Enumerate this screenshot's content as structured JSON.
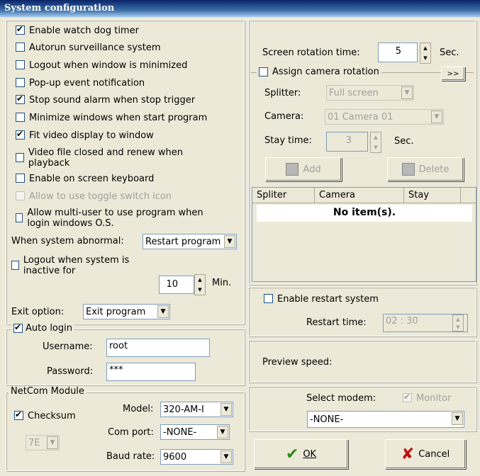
{
  "window": {
    "title": "System configuration"
  },
  "options": [
    {
      "label": "Enable watch dog timer",
      "checked": true
    },
    {
      "label": "Autorun surveillance system",
      "checked": false
    },
    {
      "label": "Logout when window is minimized",
      "checked": false
    },
    {
      "label": "Pop-up event notification",
      "checked": false
    },
    {
      "label": "Stop sound alarm when stop trigger",
      "checked": true
    },
    {
      "label": "Minimize windows when start program",
      "checked": false
    },
    {
      "label": "Fit video display to window",
      "checked": true
    },
    {
      "label": "Video file closed and renew when playback",
      "checked": false
    },
    {
      "label": "Enable on screen keyboard",
      "checked": false
    },
    {
      "label": "Allow to use toggle switch icon",
      "checked": false,
      "disabled": true
    },
    {
      "label": "Allow multi-user to use program when login windows O.S.",
      "checked": false
    }
  ],
  "abnormal": {
    "label": "When system abnormal:",
    "value": "Restart program"
  },
  "logout_inactive": {
    "label": "Logout when system is inactive for",
    "value": "10",
    "unit": "Min."
  },
  "exit_option": {
    "label": "Exit option:",
    "value": "Exit program"
  },
  "auto_login": {
    "label": "Auto login",
    "username_label": "Username:",
    "username": "root",
    "password_label": "Password:",
    "password": "***"
  },
  "netcom": {
    "title": "NetCom Module",
    "checksum_label": "Checksum",
    "checksum_value": "7E",
    "model_label": "Model:",
    "model": "320-AM-I",
    "comport_label": "Com port:",
    "comport": "-NONE-",
    "baud_label": "Baud rate:",
    "baud": "9600"
  },
  "rotation": {
    "screen_label": "Screen rotation time:",
    "screen_value": "5",
    "screen_unit": "Sec.",
    "assign_label": "Assign camera rotation",
    "more_label": ">>",
    "splitter_label": "Splitter:",
    "splitter_value": "Full screen",
    "camera_label": "Camera:",
    "camera_value": "01 Camera 01",
    "stay_label": "Stay time:",
    "stay_value": "3",
    "stay_unit": "Sec.",
    "add_label": "Add",
    "delete_label": "Delete",
    "columns": [
      "Spliter",
      "Camera",
      "Stay"
    ],
    "empty_text": "No item(s)."
  },
  "restart": {
    "label": "Enable restart system",
    "time_label": "Restart time:",
    "time_value": "02 : 30"
  },
  "preview": {
    "label": "Preview speed:"
  },
  "modem": {
    "label": "Select modem:",
    "monitor_label": "Monitor",
    "value": "-NONE-"
  },
  "buttons": {
    "ok": "OK",
    "cancel": "Cancel"
  }
}
